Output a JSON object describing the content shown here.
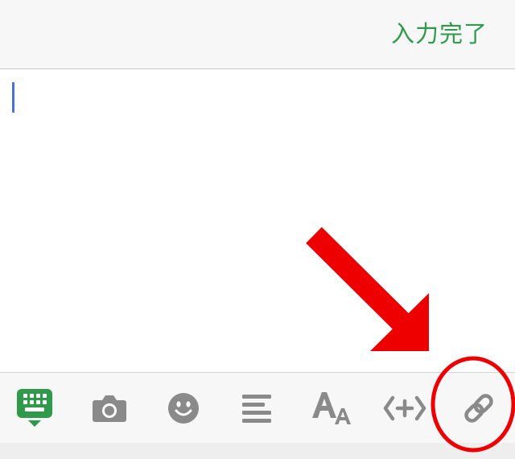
{
  "header": {
    "done_label": "入力完了"
  },
  "colors": {
    "accent_green": "#2e9a4a",
    "caret_blue": "#4a72d6",
    "icon_gray": "#8a8a8a",
    "annotation_red": "#ee0000"
  },
  "toolbar": {
    "items": [
      {
        "icon": "keyboard-icon",
        "active": true
      },
      {
        "icon": "camera-icon",
        "active": false
      },
      {
        "icon": "emoji-icon",
        "active": false
      },
      {
        "icon": "align-icon",
        "active": false
      },
      {
        "icon": "font-size-icon",
        "active": false
      },
      {
        "icon": "insert-code-icon",
        "active": false
      },
      {
        "icon": "link-icon",
        "active": false
      }
    ]
  },
  "annotation": {
    "type": "red arrow and circle highlighting link-icon"
  }
}
